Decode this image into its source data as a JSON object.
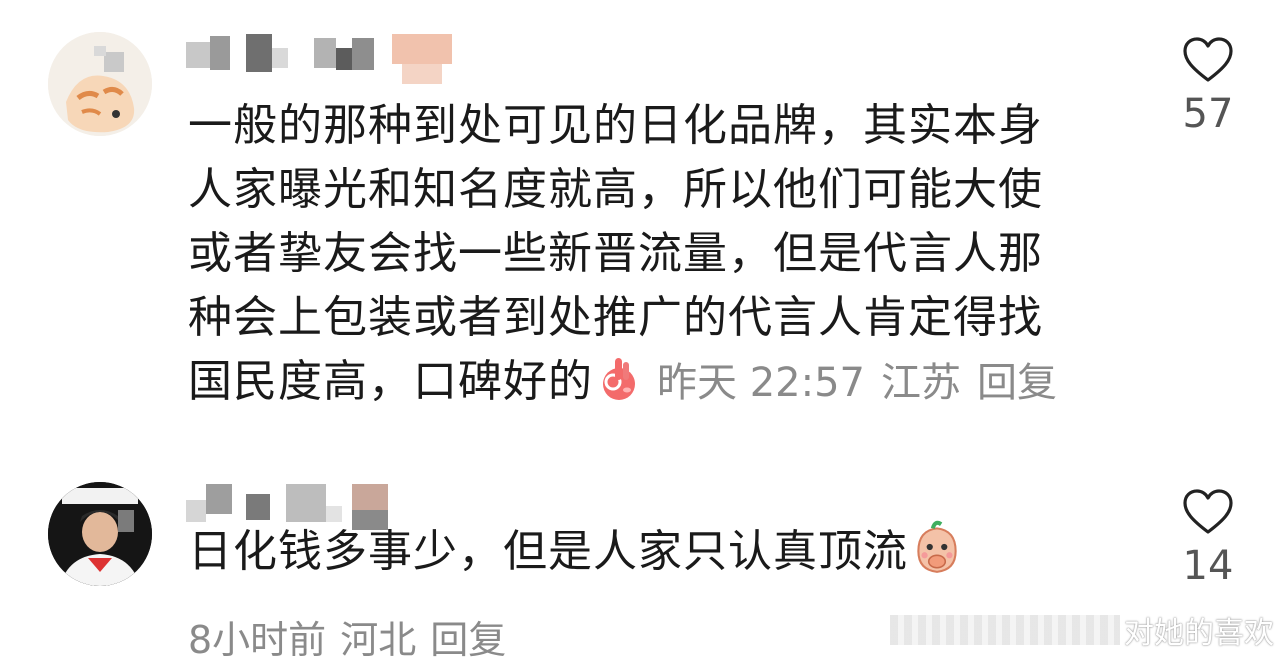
{
  "comments": [
    {
      "username": "",
      "text_lines": [
        "一般的那种到处可见的日化品牌，其实本身",
        "人家曝光和知名度就高，所以他们可能大使",
        "或者挚友会找一些新晋流量，但是代言人那",
        "种会上包装或者到处推广的代言人肯定得找",
        "国民度高，口碑好的"
      ],
      "emoji": "ok-hand-emoji-icon",
      "time": "昨天 22:57",
      "location": "江苏",
      "reply_label": "回复",
      "like_icon": "heart-outline-icon",
      "like_count": "57"
    },
    {
      "username": "",
      "text": "日化钱多事少，但是人家只认真顶流",
      "emoji": "covering-mouth-emoji-icon",
      "time": "8小时前",
      "location": "河北",
      "reply_label": "回复",
      "like_icon": "heart-outline-icon",
      "like_count": "14"
    }
  ],
  "watermark": {
    "text": "对她的喜欢"
  },
  "colors": {
    "text": "#1a1a1a",
    "meta": "#8a8a8a",
    "like_count": "#555555",
    "heart_outline": "#222222"
  }
}
